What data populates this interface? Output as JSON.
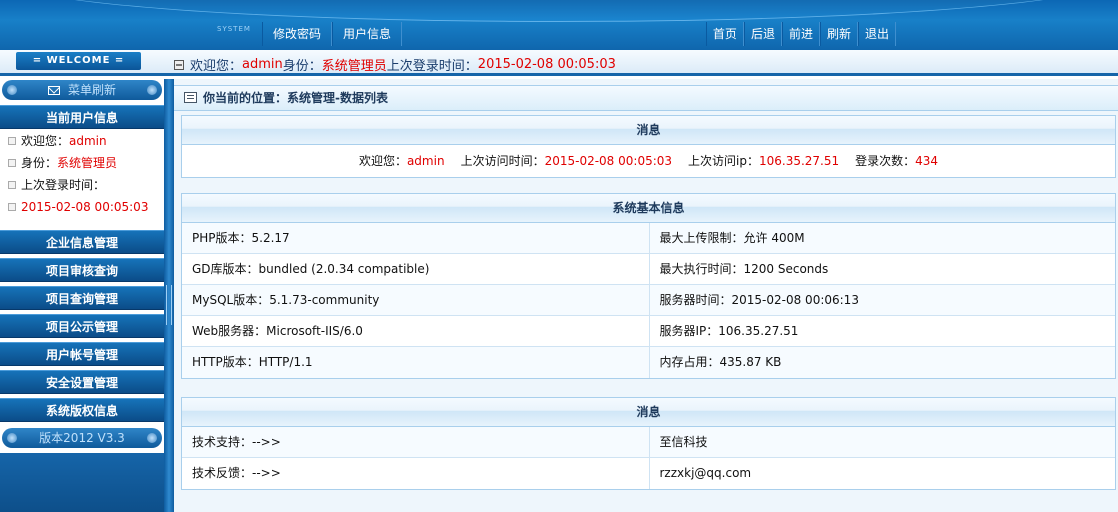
{
  "header": {
    "system_label": "SYSTEM",
    "nav_left": [
      "修改密码",
      "用户信息"
    ],
    "nav_right": [
      "首页",
      "后退",
      "前进",
      "刷新",
      "退出"
    ]
  },
  "welcome": {
    "badge": "= WELCOME =",
    "greeting_label": "欢迎您：",
    "username": "admin",
    "role_label": " 身份：",
    "role": "系统管理员",
    "last_login_label": " 上次登录时间：",
    "last_login": "2015-02-08 00:05:03"
  },
  "sidebar": {
    "menu_refresh": "菜单刷新",
    "current_user_header": "当前用户信息",
    "user_info": {
      "welcome_label": "欢迎您：",
      "username": "admin",
      "role_label": "身份：",
      "role": "系统管理员",
      "last_login_label": "上次登录时间：",
      "last_login": "2015-02-08 00:05:03"
    },
    "menu_items": [
      "企业信息管理",
      "项目审核查询",
      "项目查询管理",
      "项目公示管理",
      "用户帐号管理",
      "安全设置管理",
      "系统版权信息"
    ],
    "version": "版本2012 V3.3"
  },
  "main": {
    "breadcrumb": "你当前的位置：系统管理-数据列表",
    "message_panel": {
      "title": "消息",
      "welcome_label": "欢迎您：",
      "username": "admin",
      "last_visit_label": "上次访问时间：",
      "last_visit": "2015-02-08 00:05:03",
      "last_ip_label": "上次访问ip：",
      "last_ip": "106.35.27.51",
      "login_count_label": "登录次数：",
      "login_count": "434"
    },
    "sysinfo_panel": {
      "title": "系统基本信息",
      "rows": [
        [
          "PHP版本：5.2.17",
          "最大上传限制：允许 400M"
        ],
        [
          "GD库版本：bundled (2.0.34 compatible)",
          "最大执行时间：1200 Seconds"
        ],
        [
          "MySQL版本：5.1.73-community",
          "服务器时间：2015-02-08    00:06:13"
        ],
        [
          "Web服务器：Microsoft-IIS/6.0",
          "服务器IP：106.35.27.51"
        ],
        [
          "HTTP版本：HTTP/1.1",
          "内存占用：435.87 KB"
        ]
      ]
    },
    "support_panel": {
      "title": "消息",
      "rows": [
        [
          "技术支持：-->>",
          "至信科技"
        ],
        [
          "技术反馈：-->>",
          "rzzxkj@qq.com"
        ]
      ]
    }
  },
  "colors": {
    "header_blue": "#1880c8",
    "sidebar_blue": "#0b4c88",
    "highlight_red": "#e00000"
  }
}
